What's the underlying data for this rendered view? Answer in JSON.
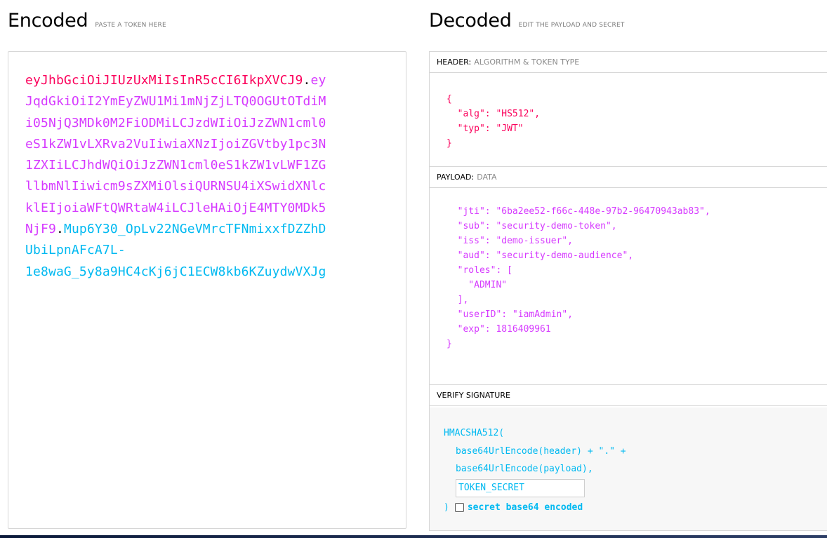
{
  "encoded": {
    "title": "Encoded",
    "subtitle": "PASTE A TOKEN HERE",
    "token_lines": [
      {
        "parts": [
          {
            "kind": "header",
            "text": "eyJhbGciOiJIUzUxMiIsInR5cCI6IkpXVCJ9"
          },
          {
            "kind": "dot",
            "text": "."
          },
          {
            "kind": "payload",
            "text": "ey"
          }
        ]
      },
      {
        "parts": [
          {
            "kind": "payload",
            "text": "JqdGkiOiI2YmEyZWU1Mi1mNjZjLTQ0OGUtOTdiM"
          }
        ]
      },
      {
        "parts": [
          {
            "kind": "payload",
            "text": "i05NjQ3MDk0M2FiODMiLCJzdWIiOiJzZWN1cml0"
          }
        ]
      },
      {
        "parts": [
          {
            "kind": "payload",
            "text": "eS1kZW1vLXRva2VuIiwiaXNzIjoiZGVtby1pc3N"
          }
        ]
      },
      {
        "parts": [
          {
            "kind": "payload",
            "text": "1ZXIiLCJhdWQiOiJzZWN1cml0eS1kZW1vLWF1ZG"
          }
        ]
      },
      {
        "parts": [
          {
            "kind": "payload",
            "text": "llbmNlIiwicm9sZXMiOlsiQURNSU4iXSwidXNlc"
          }
        ]
      },
      {
        "parts": [
          {
            "kind": "payload",
            "text": "klEIjoiaWFtQWRtaW4iLCJleHAiOjE4MTY0MDk5"
          }
        ]
      },
      {
        "parts": [
          {
            "kind": "payload",
            "text": "NjF9"
          },
          {
            "kind": "dot",
            "text": "."
          },
          {
            "kind": "sig",
            "text": "Mup6Y30_OpLv22NGeVMrcTFNmixxfDZZhD"
          }
        ]
      },
      {
        "parts": [
          {
            "kind": "sig",
            "text": "UbiLpnAFcA7L-"
          }
        ]
      },
      {
        "parts": [
          {
            "kind": "sig",
            "text": "1e8waG_5y8a9HC4cKj6jC1ECW8kb6KZuydwVXJg"
          }
        ]
      }
    ]
  },
  "decoded": {
    "title": "Decoded",
    "subtitle": "EDIT THE PAYLOAD AND SECRET",
    "header_section": {
      "label": "HEADER:",
      "sub": "ALGORITHM & TOKEN TYPE",
      "lines": [
        "{",
        "  \"alg\": \"HS512\",",
        "  \"typ\": \"JWT\"",
        "}"
      ]
    },
    "payload_section": {
      "label": "PAYLOAD:",
      "sub": "DATA",
      "lines": [
        "  \"jti\": \"6ba2ee52-f66c-448e-97b2-96470943ab83\",",
        "  \"sub\": \"security-demo-token\",",
        "  \"iss\": \"demo-issuer\",",
        "  \"aud\": \"security-demo-audience\",",
        "  \"roles\": [",
        "    \"ADMIN\"",
        "  ],",
        "  \"userID\": \"iamAdmin\",",
        "  \"exp\": 1816409961",
        "}"
      ]
    },
    "verify_section": {
      "label": "VERIFY SIGNATURE",
      "fn": "HMACSHA512(",
      "line1": "base64UrlEncode(header) + \".\" +",
      "line2": "base64UrlEncode(payload),",
      "secret_value": "TOKEN_SECRET",
      "close": ")",
      "b64_label": "secret base64 encoded",
      "b64_checked": false
    }
  },
  "colors": {
    "header": "#fb015b",
    "payload": "#d63aff",
    "signature": "#00b9f1"
  }
}
